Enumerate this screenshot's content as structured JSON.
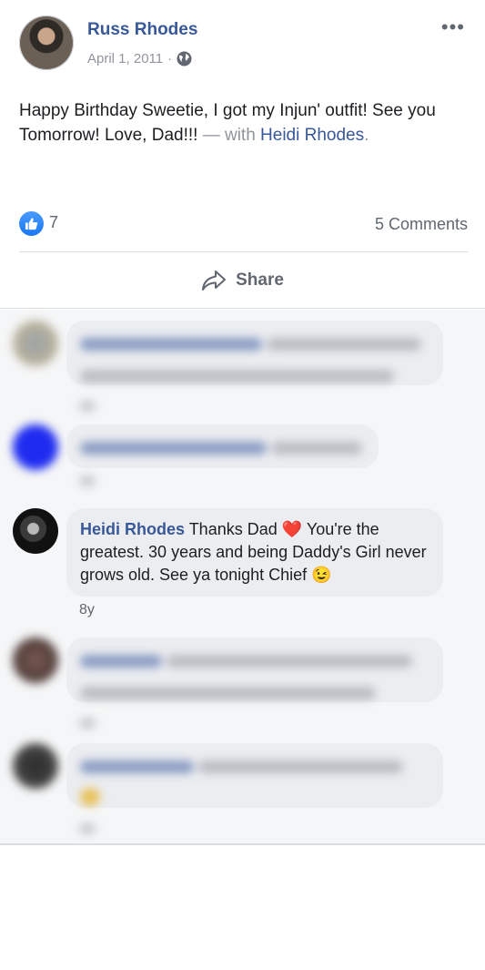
{
  "post": {
    "author": "Russ Rhodes",
    "date": "April 1, 2011",
    "separator": "·",
    "privacy_icon": "globe-icon",
    "more_label": "•••",
    "text": "Happy Birthday Sweetie, I got my Injun' outfit! See you Tomorrow! Love, Dad!!!",
    "with_text": " — with ",
    "tagged_name": "Heidi Rhodes",
    "period": "."
  },
  "stats": {
    "likes": "7",
    "comments": "5 Comments"
  },
  "actions": {
    "share_label": "Share"
  },
  "comments": {
    "featured": {
      "author": "Heidi Rhodes",
      "text_part1": " Thanks Dad ",
      "heart_emoji": "❤️",
      "text_part2": " You're the greatest. 30 years and being Daddy's Girl never grows old. See ya tonight Chief ",
      "wink_emoji": "😉",
      "time": "8y"
    }
  },
  "colors": {
    "link": "#385898",
    "like_blue": "#1877f2",
    "bubble": "#ebedf0",
    "comments_bg": "#f5f6f7"
  }
}
